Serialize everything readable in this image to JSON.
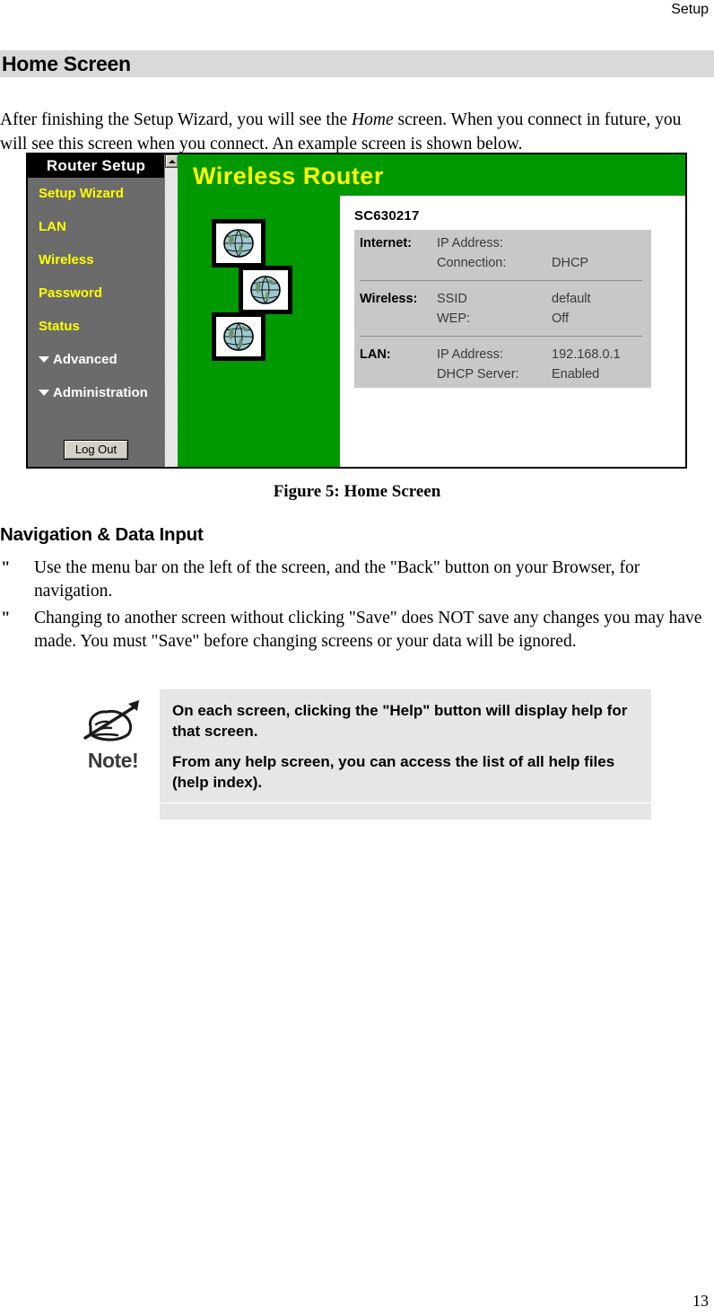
{
  "header": {
    "running_head": "Setup"
  },
  "section": {
    "title": "Home Screen",
    "intro_before": "After finishing the Setup Wizard, you will see the ",
    "intro_italic": "Home",
    "intro_after": " screen. When you connect in future, you will see this screen when you connect. An example screen is shown below."
  },
  "screenshot": {
    "menu": {
      "titlebar": "Router Setup",
      "items": [
        {
          "label": "Setup Wizard",
          "style": "link"
        },
        {
          "label": "LAN",
          "style": "link"
        },
        {
          "label": "Wireless",
          "style": "link"
        },
        {
          "label": "Password",
          "style": "link"
        },
        {
          "label": "Status",
          "style": "link"
        },
        {
          "label": "Advanced",
          "style": "group"
        },
        {
          "label": "Administration",
          "style": "group"
        }
      ],
      "logout_label": "Log Out"
    },
    "banner_title": "Wireless Router",
    "globe_count": 3,
    "status": {
      "host_name": "SC630217",
      "groups": [
        {
          "label": "Internet:",
          "rows": [
            {
              "key": "IP Address:",
              "value": ""
            },
            {
              "key": "Connection:",
              "value": "DHCP"
            }
          ]
        },
        {
          "label": "Wireless:",
          "rows": [
            {
              "key": "SSID",
              "value": "default"
            },
            {
              "key": "WEP:",
              "value": "Off"
            }
          ]
        },
        {
          "label": "LAN:",
          "rows": [
            {
              "key": "IP Address:",
              "value": "192.168.0.1"
            },
            {
              "key": "DHCP Server:",
              "value": "Enabled"
            }
          ]
        }
      ]
    },
    "colors": {
      "banner_green": "#009900",
      "banner_text_yellow": "#ffff00",
      "menu_grey": "#6b6b6b",
      "titlebar_black": "#000000",
      "status_table_grey": "#c8c8c8"
    }
  },
  "figure": {
    "caption": "Figure 5: Home Screen"
  },
  "navigation": {
    "heading": "Navigation & Data Input",
    "bullet_mark": "\"",
    "bullets": [
      "Use the menu bar on the left of the screen, and the \"Back\" button on your Browser, for navigation.",
      "Changing to another screen without clicking \"Save\" does NOT save any changes you may have made. You must \"Save\" before changing screens or your data will be ignored."
    ]
  },
  "note": {
    "icon_label": "Note!",
    "paragraphs": [
      "On each screen, clicking the \"Help\" button will display help for that screen.",
      "From any help screen, you can access the list of all help files (help index)."
    ]
  },
  "footer": {
    "page_number": "13"
  }
}
